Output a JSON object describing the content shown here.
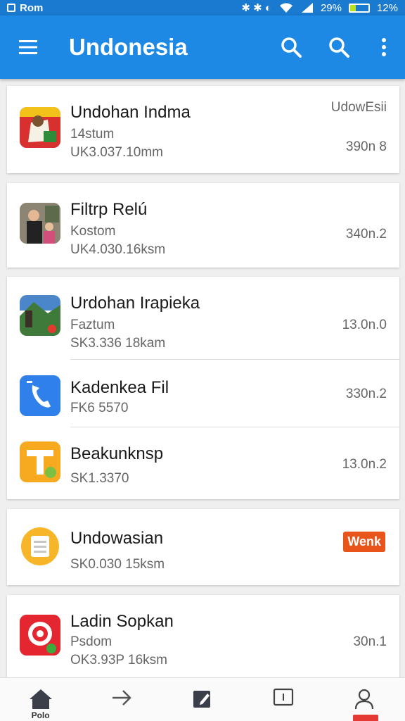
{
  "status_bar": {
    "left_text": "Rom",
    "icons_text": "✱ ✱ ◐",
    "battery_percent_text": "29%",
    "battery_level": 0.29,
    "alt_percent": "12%"
  },
  "app_bar": {
    "title": "Undonesia",
    "icons": [
      "menu-icon",
      "search-icon",
      "search-icon",
      "more-vert-icon"
    ]
  },
  "cards": [
    {
      "items": [
        {
          "title": "Undohan Indma",
          "line2": "14stum",
          "line3": "UK3.037.10mm",
          "right_top": "UdowEsii",
          "right_mid": "390n 8",
          "icon": "flag-app-icon"
        }
      ]
    },
    {
      "items": [
        {
          "title": "Filtrp Relú",
          "line2": "Kostom",
          "line3": "UK4.030.16ksm",
          "right_mid": "340n.2",
          "icon": "people-photo-icon"
        }
      ]
    },
    {
      "items": [
        {
          "title": "Urdohan Irapieka",
          "line2": "Faztum",
          "line3": "SK3.336 18kam",
          "right_mid": "13.0n.0",
          "icon": "landscape-app-icon"
        },
        {
          "title": "Kadenkea Fil",
          "line2": "FK6 5570",
          "right_mid": "330n.2",
          "icon": "phone-app-icon"
        },
        {
          "title": "Beakunknsp",
          "line3": "SK1.3370",
          "right_mid": "13.0n.2",
          "icon": "t-app-icon"
        }
      ]
    },
    {
      "items": [
        {
          "title": "Undowasian",
          "line3": "SK0.030 15ksm",
          "badge": "Wenk",
          "icon": "document-app-icon"
        }
      ]
    },
    {
      "items": [
        {
          "title": "Ladin Sopkan",
          "line2": "Psdom",
          "line3": "OK3.93P 16ksm",
          "right_mid": "30n.1",
          "icon": "target-app-icon"
        }
      ]
    }
  ],
  "bottom_nav": {
    "items": [
      {
        "icon": "home-icon",
        "label": "Polo"
      },
      {
        "icon": "arrow-right-icon",
        "label": ""
      },
      {
        "icon": "edit-icon",
        "label": ""
      },
      {
        "icon": "tablet-icon",
        "label": ""
      },
      {
        "icon": "profile-icon",
        "label": ""
      }
    ]
  },
  "colors": {
    "primary": "#1e88e5",
    "status": "#1a7ad0",
    "badge": "#e8541a"
  }
}
